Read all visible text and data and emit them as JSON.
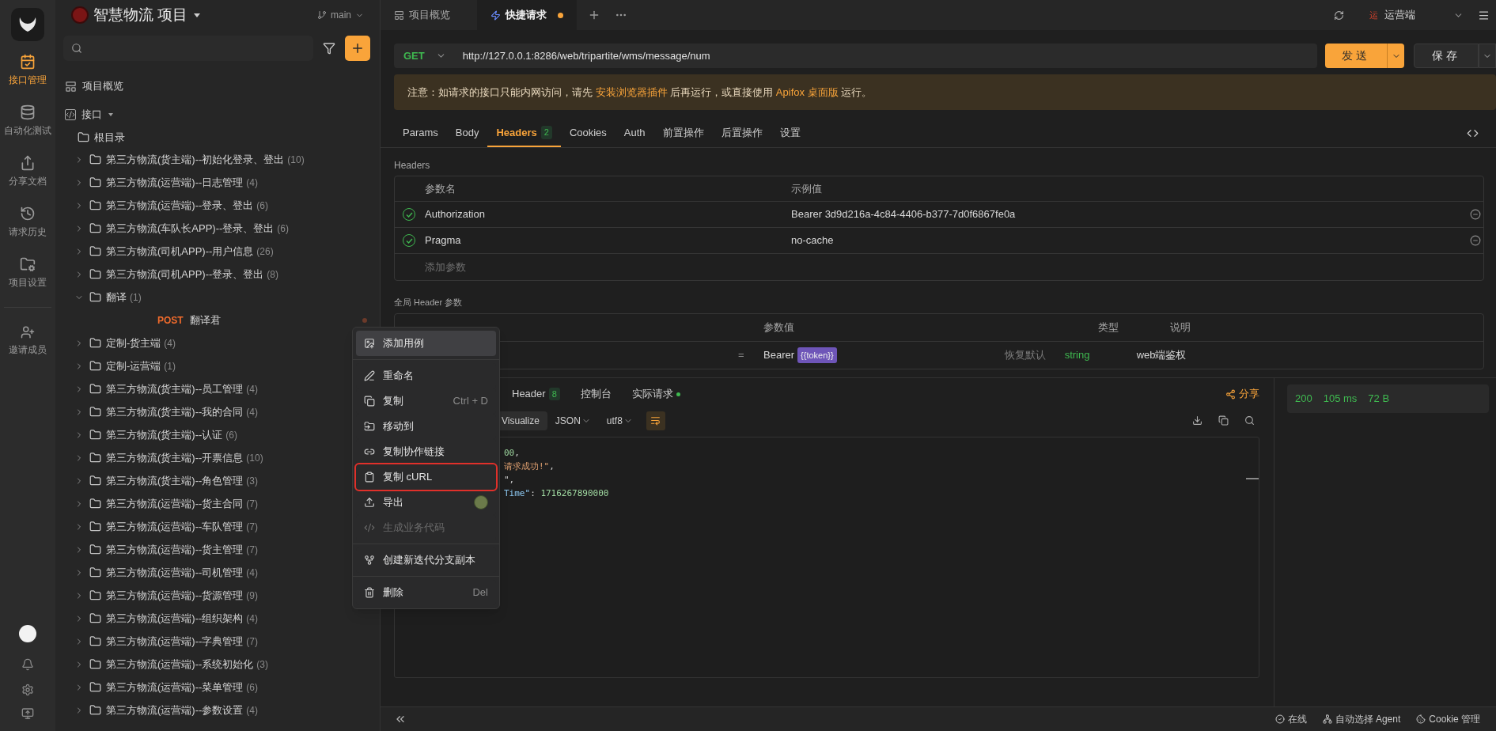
{
  "activity_bar": [
    {
      "label": "接口管理",
      "selected": true
    },
    {
      "label": "自动化测试",
      "selected": false
    },
    {
      "label": "分享文档",
      "selected": false
    },
    {
      "label": "请求历史",
      "selected": false
    },
    {
      "label": "项目设置",
      "selected": false
    }
  ],
  "invite": "邀请成员",
  "project": {
    "title": "智慧物流 项目",
    "branch": "main"
  },
  "sidebar": {
    "overview": "项目概览",
    "section": "接口",
    "root": "根目录",
    "tree": [
      {
        "label": "第三方物流(货主端)--初始化登录、登出",
        "count": "(10)",
        "expanded": false
      },
      {
        "label": "第三方物流(运营端)--日志管理",
        "count": "(4)",
        "expanded": false
      },
      {
        "label": "第三方物流(运营端)--登录、登出",
        "count": "(6)",
        "expanded": false
      },
      {
        "label": "第三方物流(车队长APP)--登录、登出",
        "count": "(6)",
        "expanded": false
      },
      {
        "label": "第三方物流(司机APP)--用户信息",
        "count": "(26)",
        "expanded": false
      },
      {
        "label": "第三方物流(司机APP)--登录、登出",
        "count": "(8)",
        "expanded": false
      },
      {
        "label": "翻译",
        "count": "(1)",
        "expanded": true,
        "children": [
          {
            "method": "POST",
            "label": "翻译君"
          }
        ]
      },
      {
        "label": "定制-货主端",
        "count": "(4)",
        "expanded": false
      },
      {
        "label": "定制-运营端",
        "count": "(1)",
        "expanded": false
      },
      {
        "label": "第三方物流(货主端)--员工管理",
        "count": "(4)",
        "expanded": false
      },
      {
        "label": "第三方物流(货主端)--我的合同",
        "count": "(4)",
        "expanded": false
      },
      {
        "label": "第三方物流(货主端)--认证",
        "count": "(6)",
        "expanded": false
      },
      {
        "label": "第三方物流(货主端)--开票信息",
        "count": "(10)",
        "expanded": false
      },
      {
        "label": "第三方物流(货主端)--角色管理",
        "count": "(3)",
        "expanded": false
      },
      {
        "label": "第三方物流(运营端)--货主合同",
        "count": "(7)",
        "expanded": false
      },
      {
        "label": "第三方物流(运营端)--车队管理",
        "count": "(7)",
        "expanded": false
      },
      {
        "label": "第三方物流(运营端)--货主管理",
        "count": "(7)",
        "expanded": false
      },
      {
        "label": "第三方物流(运营端)--司机管理",
        "count": "(4)",
        "expanded": false
      },
      {
        "label": "第三方物流(运营端)--货源管理",
        "count": "(9)",
        "expanded": false
      },
      {
        "label": "第三方物流(运营端)--组织架构",
        "count": "(4)",
        "expanded": false
      },
      {
        "label": "第三方物流(运营端)--字典管理",
        "count": "(7)",
        "expanded": false
      },
      {
        "label": "第三方物流(运营端)--系统初始化",
        "count": "(3)",
        "expanded": false
      },
      {
        "label": "第三方物流(运营端)--菜单管理",
        "count": "(6)",
        "expanded": false
      },
      {
        "label": "第三方物流(运营端)--参数设置",
        "count": "(4)",
        "expanded": false
      }
    ]
  },
  "tabs": [
    {
      "label": "项目概览",
      "selected": false,
      "unsaved": false
    },
    {
      "label": "快捷请求",
      "selected": true,
      "unsaved": true
    }
  ],
  "environment": {
    "badge": "运",
    "label": "运营端"
  },
  "request": {
    "method": "GET",
    "url": "http://127.0.0.1:8286/web/tripartite/wms/message/num",
    "send": "发送",
    "save": "保存"
  },
  "notice": [
    {
      "text": "注意：如请求的接口只能内网访问，请先 ",
      "link": false
    },
    {
      "text": "安装浏览器插件",
      "link": true
    },
    {
      "text": " 后再运行，或直接使用 ",
      "link": false
    },
    {
      "text": "Apifox 桌面版",
      "link": true
    },
    {
      "text": " 运行。",
      "link": false
    }
  ],
  "request_tabs": [
    {
      "label": "Params",
      "selected": false
    },
    {
      "label": "Body",
      "selected": false
    },
    {
      "label": "Headers",
      "badge": "2",
      "selected": true
    },
    {
      "label": "Cookies",
      "selected": false
    },
    {
      "label": "Auth",
      "selected": false
    },
    {
      "label": "前置操作",
      "selected": false
    },
    {
      "label": "后置操作",
      "selected": false
    },
    {
      "label": "设置",
      "selected": false
    }
  ],
  "headers": {
    "title": "Headers",
    "columns": [
      "参数名",
      "示例值"
    ],
    "rows": [
      {
        "name": "Authorization",
        "value": "Bearer 3d9d216a-4c84-4406-b377-7d0f6867fe0a",
        "enabled": true
      },
      {
        "name": "Pragma",
        "value": "no-cache",
        "enabled": true
      }
    ],
    "placeholder": "添加参数"
  },
  "global_headers": {
    "title": "全局 Header 参数",
    "columns": [
      "参数值",
      "类型",
      "说明"
    ],
    "rows": [
      {
        "operator": "=",
        "value": "Bearer",
        "variable": "{{token}}",
        "reset": "恢复默认",
        "type": "string",
        "description": "web端鉴权"
      }
    ]
  },
  "response": {
    "tabs": [
      {
        "label": "Header",
        "badge": "8",
        "live": false
      },
      {
        "label": "控制台",
        "live": false
      },
      {
        "label": "实际请求",
        "live": true
      }
    ],
    "share": "分享",
    "view": "Visualize",
    "format": "JSON",
    "encoding": "utf8",
    "wrap": true,
    "code_lines": [
      [
        {
          "t": "00",
          "kind": "number"
        },
        {
          "t": ",",
          "kind": "punct"
        }
      ],
      [
        {
          "t": "请求成功!\"",
          "kind": "string"
        },
        {
          "t": ",",
          "kind": "punct"
        }
      ],
      [
        {
          "t": "\",",
          "kind": "punct"
        }
      ],
      [
        {
          "t": "Time\"",
          "kind": "key"
        },
        {
          "t": ": ",
          "kind": "punct"
        },
        {
          "t": "1716267890000",
          "kind": "number"
        }
      ]
    ],
    "status": "200",
    "time": "105 ms",
    "size": "72 B"
  },
  "context_menu": {
    "groups": [
      [
        {
          "label": "添加用例",
          "selected": true,
          "disabled": false,
          "outlined": false
        }
      ],
      [
        {
          "label": "重命名",
          "selected": false,
          "disabled": false,
          "outlined": false
        },
        {
          "label": "复制",
          "shortcut": "Ctrl + D",
          "selected": false,
          "disabled": false,
          "outlined": false
        },
        {
          "label": "移动到",
          "selected": false,
          "disabled": false,
          "outlined": false
        },
        {
          "label": "复制协作链接",
          "selected": false,
          "disabled": false,
          "outlined": false
        },
        {
          "label": "复制 cURL",
          "selected": false,
          "disabled": false,
          "outlined": true
        },
        {
          "label": "导出",
          "selected": false,
          "disabled": false,
          "outlined": false,
          "avatar": true
        },
        {
          "label": "生成业务代码",
          "selected": false,
          "disabled": true,
          "outlined": false
        }
      ],
      [
        {
          "label": "创建新迭代分支副本",
          "selected": false,
          "disabled": false,
          "outlined": false
        }
      ],
      [
        {
          "label": "删除",
          "shortcut": "Del",
          "selected": false,
          "disabled": false,
          "outlined": false
        }
      ]
    ]
  },
  "status_bar": [
    "在线",
    "自动选择 Agent",
    "Cookie 管理"
  ]
}
